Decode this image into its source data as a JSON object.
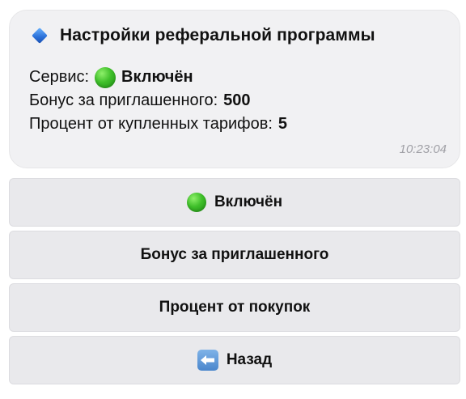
{
  "message": {
    "title": "Настройки реферальной программы",
    "title_icon": "blue-diamond-icon",
    "service_label": "Сервис:",
    "service_status_icon": "green-circle-icon",
    "service_value": "Включён",
    "bonus_label": "Бонус за приглашенного:",
    "bonus_value": "500",
    "percent_label": "Процент от купленных тарифов:",
    "percent_value": "5",
    "time": "10:23:04"
  },
  "buttons": {
    "toggle_label": "Включён",
    "toggle_icon": "green-circle-icon",
    "bonus_label": "Бонус за приглашенного",
    "percent_label": "Процент от покупок",
    "back_label": "Назад",
    "back_icon": "back-arrow-icon"
  },
  "colors": {
    "bubble_bg": "#f1f1f3",
    "button_bg": "#e9e9ec",
    "accent_green": "#3fbf2a",
    "accent_blue": "#2a6fd8",
    "time_text": "#a0a0a6"
  }
}
